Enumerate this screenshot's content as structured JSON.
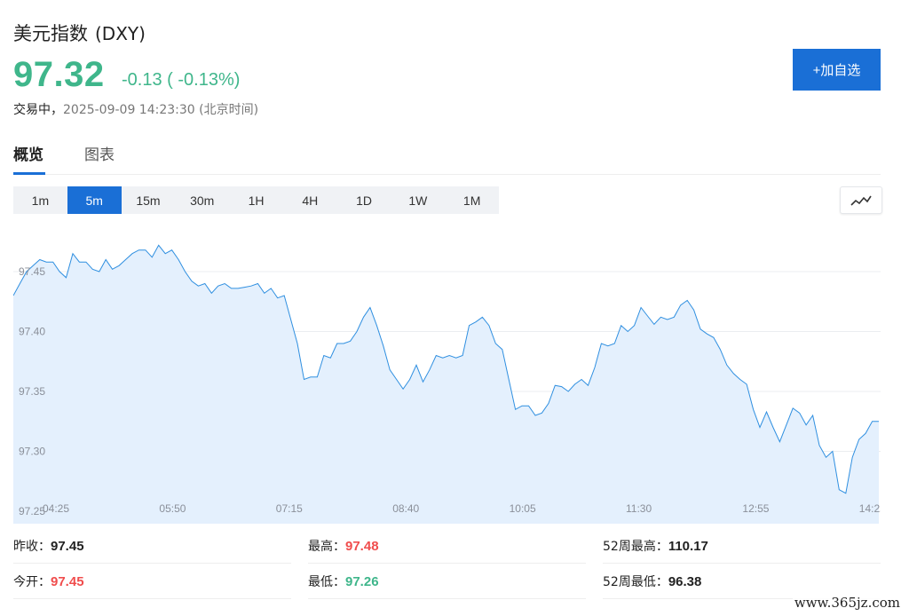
{
  "header": {
    "name": "美元指数",
    "code": "(DXY)",
    "price": "97.32",
    "change": "-0.13 ( -0.13%)",
    "status": "交易中，",
    "time": "2025-09-09 14:23:30 (北京时间)",
    "add_label": "+加自选"
  },
  "colors": {
    "up": "#f04d4d",
    "down": "#3fb68b",
    "accent": "#1a6fd6"
  },
  "tabs": [
    {
      "label": "概览",
      "active": true
    },
    {
      "label": "图表",
      "active": false
    }
  ],
  "intervals": [
    "1m",
    "5m",
    "15m",
    "30m",
    "1H",
    "4H",
    "1D",
    "1W",
    "1M"
  ],
  "active_interval": "5m",
  "chart_type_icon": "line-chart-icon",
  "chart_data": {
    "type": "area",
    "ylim": [
      97.25,
      97.49
    ],
    "yticks": [
      "97.25",
      "97.30",
      "97.35",
      "97.40",
      "97.45"
    ],
    "xticks": [
      "04:25",
      "05:50",
      "07:15",
      "08:40",
      "10:05",
      "11:30",
      "12:55",
      "14:2"
    ],
    "grid": true,
    "values": [
      97.43,
      97.44,
      97.45,
      97.455,
      97.46,
      97.458,
      97.458,
      97.45,
      97.445,
      97.465,
      97.458,
      97.458,
      97.452,
      97.45,
      97.46,
      97.452,
      97.455,
      97.46,
      97.465,
      97.468,
      97.468,
      97.462,
      97.472,
      97.465,
      97.468,
      97.46,
      97.45,
      97.442,
      97.438,
      97.44,
      97.432,
      97.438,
      97.44,
      97.436,
      97.436,
      97.437,
      97.438,
      97.44,
      97.432,
      97.436,
      97.428,
      97.43,
      97.41,
      97.39,
      97.36,
      97.362,
      97.362,
      97.38,
      97.378,
      97.39,
      97.39,
      97.392,
      97.4,
      97.412,
      97.42,
      97.405,
      97.388,
      97.368,
      97.36,
      97.352,
      97.36,
      97.372,
      97.358,
      97.368,
      97.38,
      97.378,
      97.38,
      97.378,
      97.38,
      97.405,
      97.408,
      97.412,
      97.405,
      97.39,
      97.385,
      97.36,
      97.335,
      97.338,
      97.338,
      97.33,
      97.332,
      97.34,
      97.355,
      97.354,
      97.35,
      97.356,
      97.36,
      97.355,
      97.37,
      97.39,
      97.388,
      97.39,
      97.405,
      97.4,
      97.405,
      97.42,
      97.413,
      97.406,
      97.412,
      97.41,
      97.412,
      97.422,
      97.426,
      97.418,
      97.402,
      97.398,
      97.395,
      97.385,
      97.372,
      97.365,
      97.36,
      97.356,
      97.335,
      97.32,
      97.333,
      97.32,
      97.308,
      97.322,
      97.336,
      97.332,
      97.322,
      97.33,
      97.305,
      97.295,
      97.3,
      97.268,
      97.265,
      97.295,
      97.31,
      97.315,
      97.325,
      97.325
    ]
  },
  "stats": [
    {
      "label": "昨收：",
      "value": "97.45",
      "tone": "dark"
    },
    {
      "label": "最高：",
      "value": "97.48",
      "tone": "red"
    },
    {
      "label": "52周最高：",
      "value": "110.17",
      "tone": "dark"
    },
    {
      "label": "今开：",
      "value": "97.45",
      "tone": "red"
    },
    {
      "label": "最低：",
      "value": "97.26",
      "tone": "green"
    },
    {
      "label": "52周最低：",
      "value": "96.38",
      "tone": "dark"
    }
  ],
  "watermark": "www.365jz.com"
}
